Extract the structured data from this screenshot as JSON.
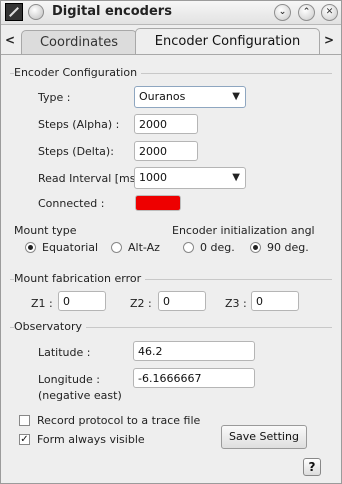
{
  "window": {
    "title": "Digital encoders",
    "buttons": {
      "minimize": "⌄",
      "maximize": "⌃",
      "close": "✕"
    }
  },
  "tabs": {
    "prev": "<",
    "next": ">",
    "items": [
      {
        "label": "Coordinates",
        "active": false
      },
      {
        "label": "Encoder Configuration",
        "active": true
      }
    ]
  },
  "encoder_config": {
    "group_title": "Encoder Configuration",
    "type_label": "Type :",
    "type_value": "Ouranos",
    "steps_alpha_label": "Steps (Alpha) :",
    "steps_alpha_value": "2000",
    "steps_delta_label": "Steps (Delta):",
    "steps_delta_value": "2000",
    "read_interval_label": "Read Interval [ms",
    "read_interval_value": "1000",
    "connected_label": "Connected :",
    "connected_color": "#ee0000"
  },
  "mount_type": {
    "title": "Mount type",
    "options": [
      {
        "label": "Equatorial",
        "selected": true
      },
      {
        "label": "Alt-Az",
        "selected": false
      }
    ]
  },
  "encoder_init": {
    "title": "Encoder initialization angl",
    "options": [
      {
        "label": "0 deg.",
        "selected": false
      },
      {
        "label": "90 deg.",
        "selected": true
      }
    ]
  },
  "mount_error": {
    "title": "Mount fabrication error",
    "z1_label": "Z1 :",
    "z1_value": "0",
    "z2_label": "Z2 :",
    "z2_value": "0",
    "z3_label": "Z3 :",
    "z3_value": "0"
  },
  "observatory": {
    "title": "Observatory",
    "latitude_label": "Latitude :",
    "latitude_value": "46.2",
    "longitude_label": "Longitude :",
    "longitude_sublabel": "(negative east)",
    "longitude_value": "-6.1666667"
  },
  "options": {
    "record_label": "Record protocol to a trace file",
    "record_checked": false,
    "always_visible_label": "Form always visible",
    "always_visible_checked": true,
    "save_button": "Save Setting",
    "help_button": "?"
  }
}
